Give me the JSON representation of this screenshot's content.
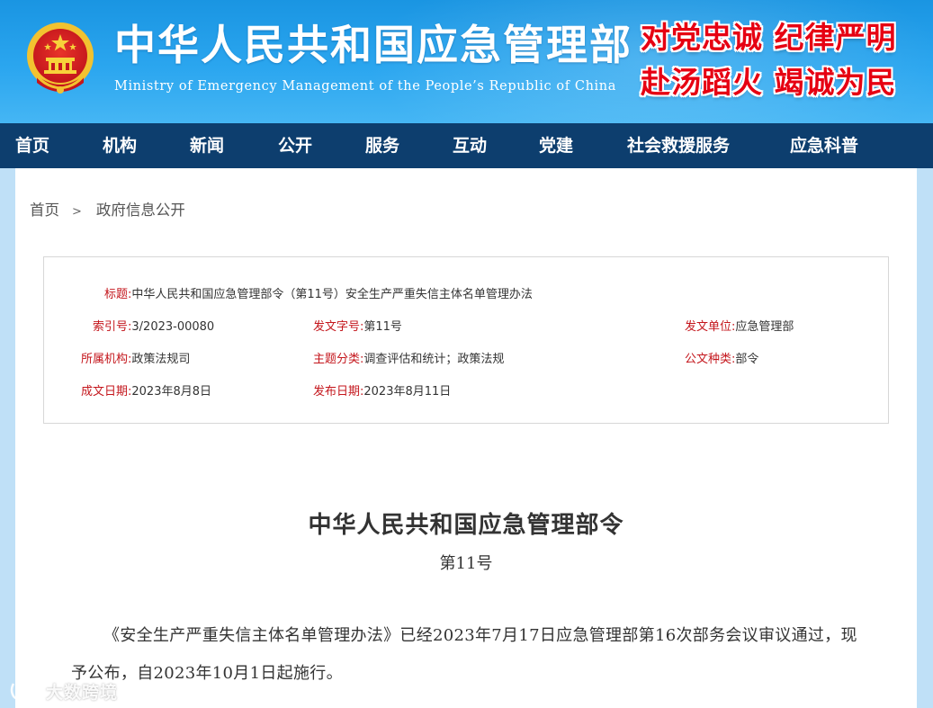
{
  "header": {
    "title": "中华人民共和国应急管理部",
    "subtitle": "Ministry of Emergency Management of the People’s Republic of China",
    "slogans": [
      "对党忠诚 纪律严明",
      "赴汤蹈火 竭诚为民"
    ]
  },
  "nav": {
    "items": [
      "首页",
      "机构",
      "新闻",
      "公开",
      "服务",
      "互动",
      "党建",
      "社会救援服务",
      "应急科普"
    ]
  },
  "breadcrumb": {
    "home": "首页",
    "separator": ">",
    "current": "政府信息公开"
  },
  "meta": {
    "title_label": "标题:",
    "title_value": "中华人民共和国应急管理部令（第11号）安全生产严重失信主体名单管理办法",
    "index_label": "索引号:",
    "index_value": "3/2023-00080",
    "docno_label": "发文字号:",
    "docno_value": "第11号",
    "issuer_label": "发文单位:",
    "issuer_value": "应急管理部",
    "org_label": "所属机构:",
    "org_value": "政策法规司",
    "topic_label": "主题分类:",
    "topic_value": "调查评估和统计；政策法规",
    "doctype_label": "公文种类:",
    "doctype_value": "部令",
    "created_label": "成文日期:",
    "created_value": "2023年8月8日",
    "published_label": "发布日期:",
    "published_value": "2023年8月11日"
  },
  "document": {
    "title": "中华人民共和国应急管理部令",
    "number": "第11号",
    "paragraph": "《安全生产严重失信主体名单管理办法》已经2023年7月17日应急管理部第16次部务会议审议通过，现予公布，自2023年10月1日起施行。"
  },
  "watermark": {
    "text": "大数跨境"
  },
  "colors": {
    "header_blue": "#1a95e2",
    "nav_navy": "#0d3e6e",
    "label_red": "#c4161c",
    "slogan_red": "#e60012"
  }
}
